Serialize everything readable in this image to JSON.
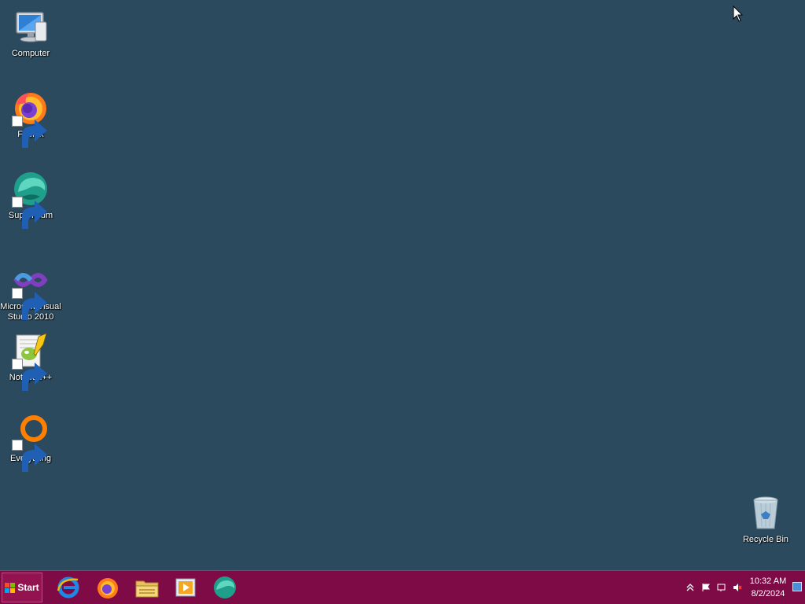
{
  "desktop": {
    "background_color": "#2b4a5e",
    "icons": [
      {
        "name": "computer",
        "label": "Computer"
      },
      {
        "name": "firefox",
        "label": "Firefox"
      },
      {
        "name": "supermium",
        "label": "Supermium"
      },
      {
        "name": "visual-studio",
        "label": "Microsoft Visual Studio 2010"
      },
      {
        "name": "notepadpp",
        "label": "Notepad++"
      },
      {
        "name": "everything",
        "label": "Everything"
      },
      {
        "name": "recycle-bin",
        "label": "Recycle Bin"
      }
    ]
  },
  "taskbar": {
    "color": "#7e0a46",
    "start_label": "Start",
    "pinned": [
      {
        "icon": "internet-explorer-icon"
      },
      {
        "icon": "firefox-icon"
      },
      {
        "icon": "file-explorer-icon"
      },
      {
        "icon": "media-player-icon"
      },
      {
        "icon": "supermium-icon"
      }
    ],
    "tray_icons": [
      "show-hidden-icons-icon",
      "action-center-flag-icon",
      "network-icon",
      "volume-icon"
    ],
    "clock": {
      "time": "10:32 AM",
      "date": "8/2/2024"
    }
  }
}
